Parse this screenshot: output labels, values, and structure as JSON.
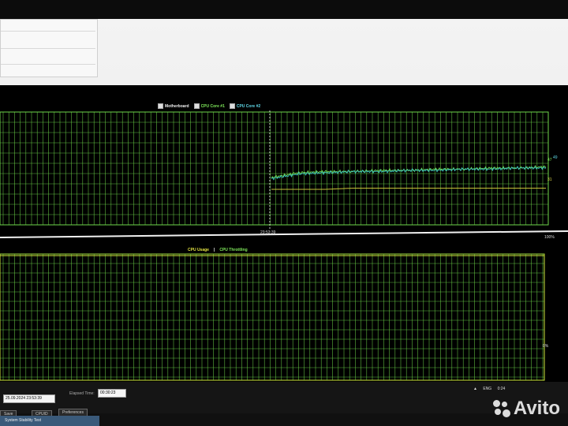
{
  "temp_legend": {
    "motherboard": "Motherboard",
    "core1": "CPU Core #1",
    "core2": "CPU Core #2"
  },
  "temp_graph": {
    "time_marker": "23:53:39",
    "right_value_top": "49",
    "right_value_mid": "47",
    "right_value_low": "31"
  },
  "cpu_legend": {
    "usage": "CPU Usage",
    "sep": "|",
    "throttling": "CPU Throttling"
  },
  "cpu_graph": {
    "scale_top": "100%",
    "scale_bottom": "0%"
  },
  "status": {
    "start_value": "25.09.2024 23:53:39",
    "elapsed_label": "Elapsed Time:",
    "elapsed_value": "00:30:23"
  },
  "buttons": {
    "save": "Save",
    "cpuid": "CPUID",
    "preferences": "Preferences"
  },
  "taskbar": {
    "lang": "ENG",
    "time": "0:24",
    "app": "System Stability Test"
  },
  "watermark": {
    "brand": "Avito"
  },
  "colors": {
    "grid": "#6fd64a",
    "core": "#3cc4c0",
    "mobo": "#c8c03a",
    "cpu_grid": "#cfe63b"
  },
  "chart_data": [
    {
      "type": "line",
      "series": [
        {
          "name": "Motherboard",
          "values": [
            30,
            30,
            30,
            31,
            31,
            31,
            31,
            31,
            31,
            31,
            31
          ]
        },
        {
          "name": "CPU Core #1",
          "values": [
            40,
            44,
            45,
            45,
            46,
            46,
            47,
            47,
            48,
            48,
            49
          ]
        },
        {
          "name": "CPU Core #2",
          "values": [
            39,
            43,
            44,
            45,
            45,
            46,
            46,
            47,
            47,
            48,
            48
          ]
        }
      ],
      "x": [
        "23:53:39",
        "",
        "",
        "",
        "",
        "",
        "",
        "",
        "",
        "",
        ""
      ],
      "ylim": [
        0,
        100
      ]
    },
    {
      "type": "line",
      "series": [
        {
          "name": "CPU Usage",
          "values": []
        },
        {
          "name": "CPU Throttling",
          "values": []
        }
      ],
      "ylim": [
        0,
        100
      ]
    }
  ]
}
